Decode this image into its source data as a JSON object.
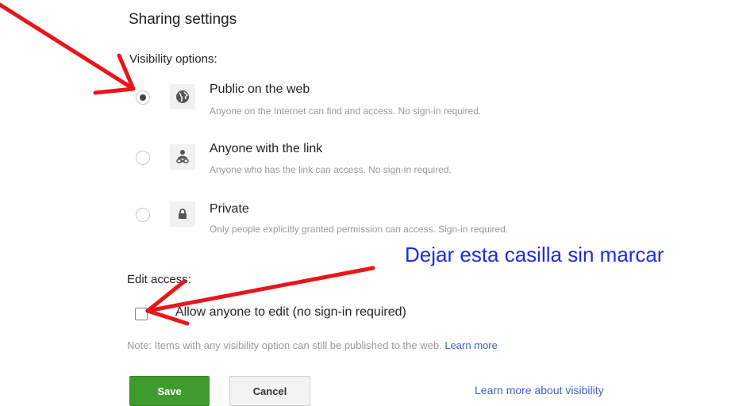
{
  "title": "Sharing settings",
  "visibility": {
    "label": "Visibility options:",
    "options": [
      {
        "title": "Public on the web",
        "description": "Anyone on the Internet can find and access. No sign-in required.",
        "icon": "globe-icon",
        "selected": true
      },
      {
        "title": "Anyone with the link",
        "description": "Anyone who has the link can access. No sign-in required.",
        "icon": "person-link-icon",
        "selected": false
      },
      {
        "title": "Private",
        "description": "Only people explicitly granted permission can access. Sign-in required.",
        "icon": "lock-icon",
        "selected": false
      }
    ]
  },
  "edit_access": {
    "label": "Edit access:",
    "checkbox_label": "Allow anyone to edit (no sign-in required)",
    "checked": false
  },
  "note": {
    "text": "Note: Items with any visibility option can still be published to the web.",
    "link": "Learn more"
  },
  "buttons": {
    "save": "Save",
    "cancel": "Cancel"
  },
  "learn_more_visibility": "Learn more about visibility",
  "annotation": {
    "text": "Dejar esta casilla sin marcar",
    "arrow_color": "#e8161b",
    "text_color": "#1c2de0"
  },
  "colors": {
    "save_button": "#3f9b2e",
    "link": "#3b62c6"
  }
}
